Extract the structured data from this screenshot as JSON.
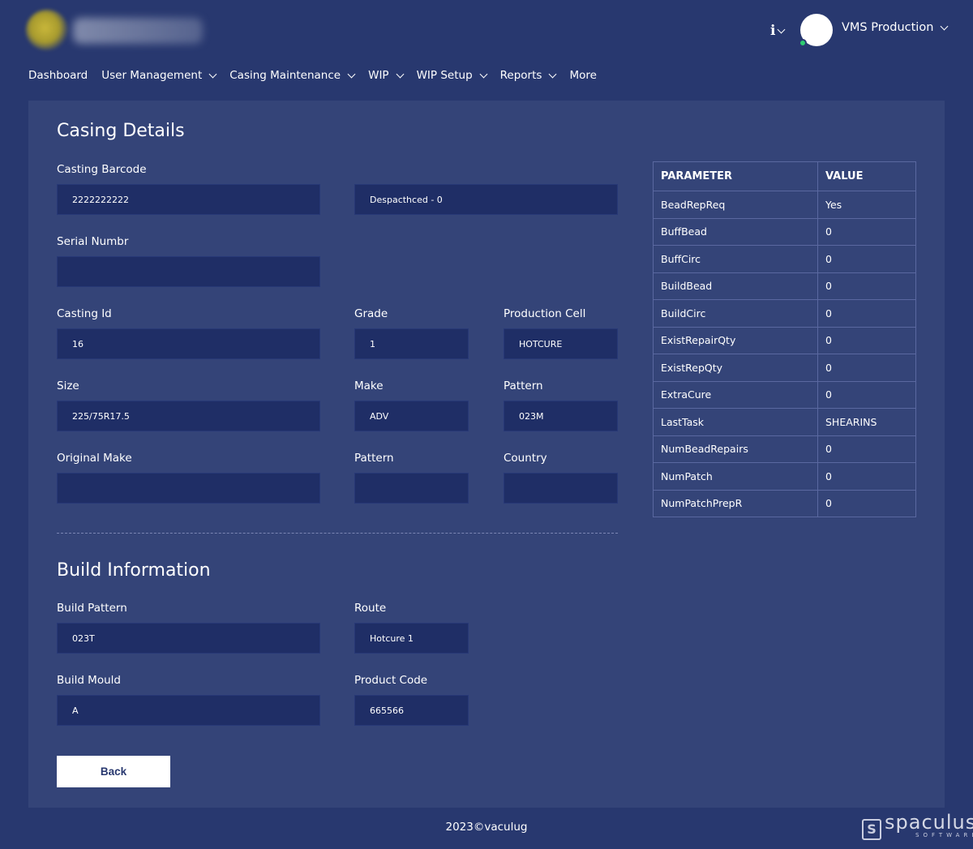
{
  "header": {
    "info_icon": "info-icon",
    "user_name": "VMS Production"
  },
  "nav": {
    "items": [
      {
        "label": "Dashboard",
        "has_dropdown": false
      },
      {
        "label": "User Management",
        "has_dropdown": true
      },
      {
        "label": "Casing Maintenance",
        "has_dropdown": true
      },
      {
        "label": "WIP",
        "has_dropdown": true
      },
      {
        "label": "WIP Setup",
        "has_dropdown": true
      },
      {
        "label": "Reports",
        "has_dropdown": true
      },
      {
        "label": "More",
        "has_dropdown": false
      }
    ]
  },
  "casing": {
    "title": "Casing Details",
    "barcode_label": "Casting Barcode",
    "barcode_value": "2222222222",
    "status_value": "Despacthced - 0",
    "serial_label": "Serial Numbr",
    "serial_value": "",
    "casting_id_label": "Casting Id",
    "casting_id_value": "16",
    "grade_label": "Grade",
    "grade_value": "1",
    "production_cell_label": "Production Cell",
    "production_cell_value": "HOTCURE",
    "size_label": "Size",
    "size_value": "225/75R17.5",
    "make_label": "Make",
    "make_value": "ADV",
    "pattern_label": "Pattern",
    "pattern_value": "023M",
    "original_make_label": "Original Make",
    "original_make_value": "",
    "pattern2_label": "Pattern",
    "pattern2_value": "",
    "country_label": "Country",
    "country_value": ""
  },
  "build": {
    "title": "Build Information",
    "build_pattern_label": "Build Pattern",
    "build_pattern_value": "023T",
    "route_label": "Route",
    "route_value": "Hotcure 1",
    "build_mould_label": "Build Mould",
    "build_mould_value": "A",
    "product_code_label": "Product Code",
    "product_code_value": "665566"
  },
  "back_label": "Back",
  "params": {
    "headers": [
      "PARAMETER",
      "VALUE"
    ],
    "rows": [
      {
        "parameter": "BeadRepReq",
        "value": "Yes"
      },
      {
        "parameter": "BuffBead",
        "value": "0"
      },
      {
        "parameter": "BuffCirc",
        "value": "0"
      },
      {
        "parameter": "BuildBead",
        "value": "0"
      },
      {
        "parameter": "BuildCirc",
        "value": "0"
      },
      {
        "parameter": "ExistRepairQty",
        "value": "0"
      },
      {
        "parameter": "ExistRepQty",
        "value": "0"
      },
      {
        "parameter": "ExtraCure",
        "value": "0"
      },
      {
        "parameter": "LastTask",
        "value": "SHEARINS"
      },
      {
        "parameter": "NumBeadRepairs",
        "value": "0"
      },
      {
        "parameter": "NumPatch",
        "value": "0"
      },
      {
        "parameter": "NumPatchPrepR",
        "value": "0"
      }
    ]
  },
  "footer": {
    "copyright": "2023©vaculug",
    "brand_name": "spaculus",
    "brand_sub": "SOFTWARE"
  }
}
